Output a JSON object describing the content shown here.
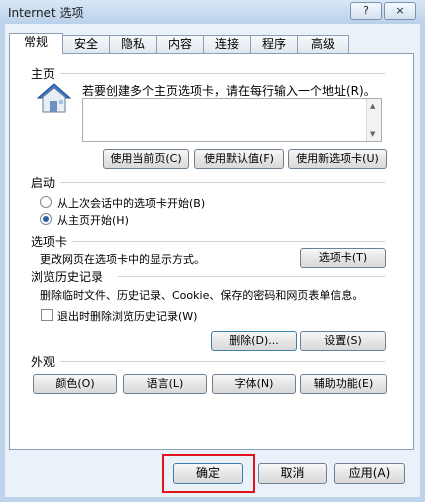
{
  "window": {
    "title": "Internet 选项",
    "help_label": "?",
    "close_label": "×"
  },
  "tabs": [
    {
      "label": "常规"
    },
    {
      "label": "安全"
    },
    {
      "label": "隐私"
    },
    {
      "label": "内容"
    },
    {
      "label": "连接"
    },
    {
      "label": "程序"
    },
    {
      "label": "高级"
    }
  ],
  "home": {
    "section": "主页",
    "description": "若要创建多个主页选项卡，请在每行输入一个地址(R)。",
    "textbox_value": "",
    "buttons": {
      "use_current": "使用当前页(C)",
      "use_default": "使用默认值(F)",
      "use_new_tab": "使用新选项卡(U)"
    }
  },
  "startup": {
    "section": "启动",
    "options": [
      {
        "label": "从上次会话中的选项卡开始(B)",
        "selected": false
      },
      {
        "label": "从主页开始(H)",
        "selected": true
      }
    ]
  },
  "tabs_section": {
    "section": "选项卡",
    "description": "更改网页在选项卡中的显示方式。",
    "button": "选项卡(T)"
  },
  "history": {
    "section": "浏览历史记录",
    "description": "删除临时文件、历史记录、Cookie、保存的密码和网页表单信息。",
    "checkbox_label": "退出时删除浏览历史记录(W)",
    "checkbox_checked": false,
    "delete_button": "删除(D)...",
    "settings_button": "设置(S)"
  },
  "appearance": {
    "section": "外观",
    "buttons": {
      "colors": "颜色(O)",
      "languages": "语言(L)",
      "fonts": "字体(N)",
      "accessibility": "辅助功能(E)"
    }
  },
  "footer": {
    "ok": "确定",
    "cancel": "取消",
    "apply": "应用(A)"
  },
  "colors": {
    "highlight": "#e0141e",
    "panel_bg": "#ffffff",
    "window_frame": "#bcd3ea"
  },
  "icons": {
    "home": "house-icon"
  }
}
